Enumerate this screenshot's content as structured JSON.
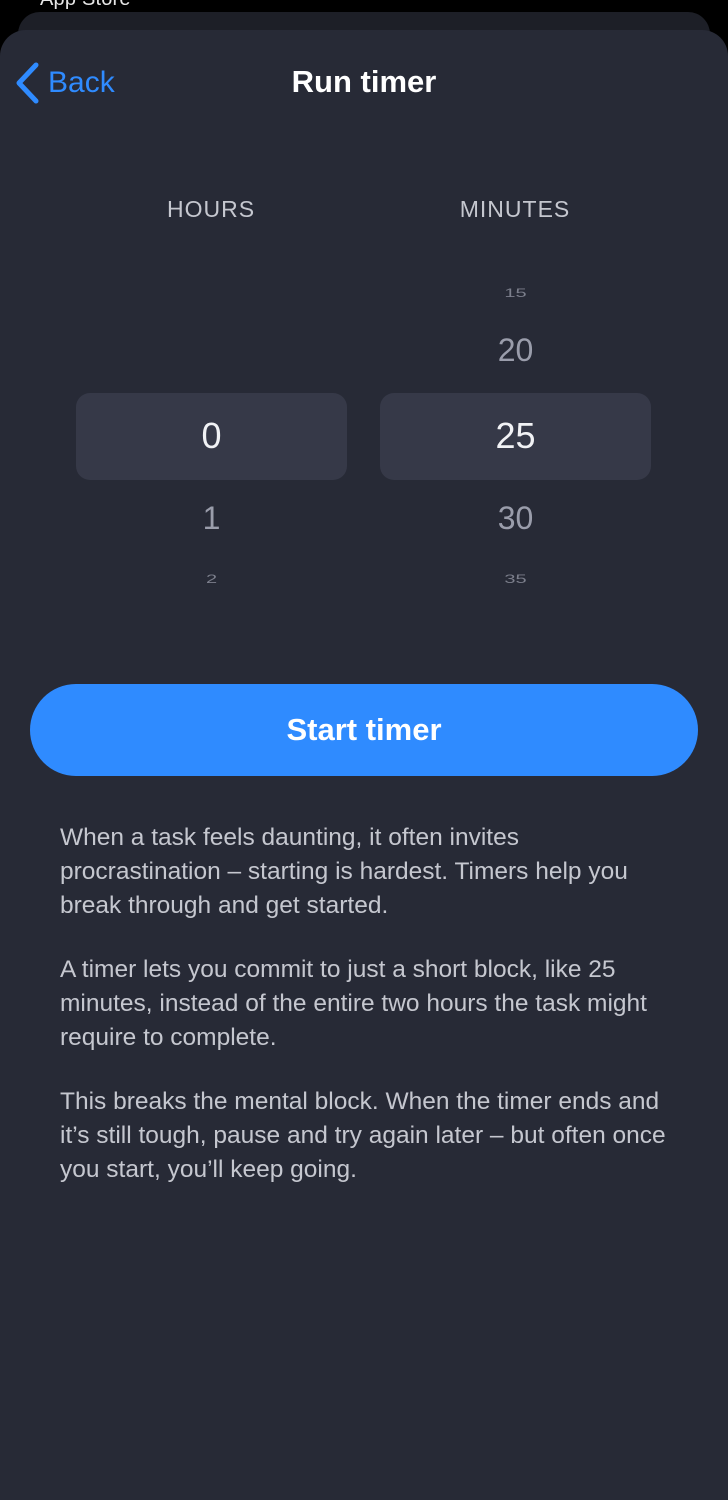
{
  "status_bar": {
    "back_app_label": "App Store"
  },
  "nav": {
    "back_label": "Back",
    "title": "Run timer"
  },
  "picker": {
    "hours_header": "HOURS",
    "minutes_header": "MINUTES",
    "hours": {
      "above2": "",
      "above1": "",
      "selected": "0",
      "below1": "1",
      "below2": "2"
    },
    "minutes": {
      "above2": "15",
      "above1": "20",
      "selected": "25",
      "below1": "30",
      "below2": "35"
    }
  },
  "start_button_label": "Start timer",
  "paragraphs": [
    "When a task feels daunting, it often invites procrastination – starting is hardest. Timers help you break through and get started.",
    "A timer lets you commit to just a short block, like 25 minutes, instead of the entire two hours the task might require to complete.",
    "This breaks the mental block. When the timer ends and it’s still tough, pause and try again later – but often once you start, you’ll keep going."
  ],
  "colors": {
    "accent": "#2f8bff",
    "sheet_background": "#272a36",
    "picker_highlight": "#363948",
    "body_text": "#c5c7cf"
  },
  "icons": {
    "back": "chevron-left-icon"
  }
}
